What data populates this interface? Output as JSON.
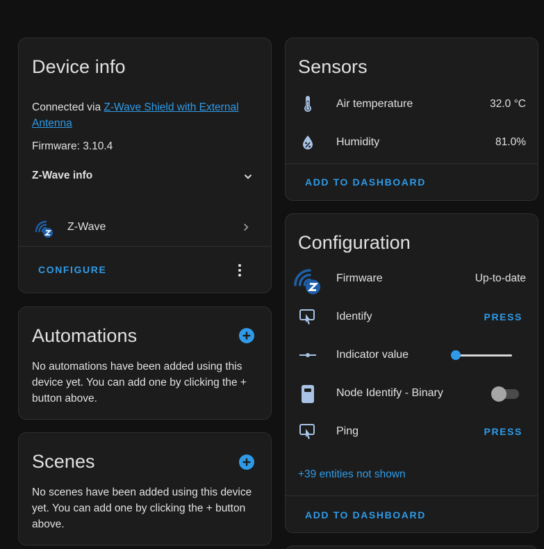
{
  "device_info": {
    "title": "Device info",
    "connected_prefix": "Connected via ",
    "connected_link_line1": "Z-Wave Shield with External",
    "connected_link_line2": "Antenna",
    "firmware": "Firmware: 3.10.4",
    "zwave_info_label": "Z-Wave info",
    "integration_label": "Z-Wave",
    "configure_label": "CONFIGURE"
  },
  "automations": {
    "title": "Automations",
    "description": "No automations have been added using this device yet. You can add one by clicking the + button above."
  },
  "scenes": {
    "title": "Scenes",
    "description": "No scenes have been added using this device yet. You can add one by clicking the + button above."
  },
  "sensors": {
    "title": "Sensors",
    "rows": [
      {
        "label": "Air temperature",
        "value": "32.0 °C",
        "icon": "thermometer-icon"
      },
      {
        "label": "Humidity",
        "value": "81.0%",
        "icon": "water-percent-icon"
      }
    ],
    "add_to_dashboard": "ADD TO DASHBOARD"
  },
  "configuration": {
    "title": "Configuration",
    "rows": [
      {
        "label": "Firmware",
        "value": "Up-to-date",
        "icon": "zwave-logo-icon"
      },
      {
        "label": "Identify",
        "value": "PRESS",
        "icon": "gesture-tap-button-icon"
      },
      {
        "label": "Indicator value",
        "icon": "slider-icon",
        "slider_value": 0
      },
      {
        "label": "Node Identify - Binary",
        "icon": "remote-icon",
        "toggle_on": false
      },
      {
        "label": "Ping",
        "value": "PRESS",
        "icon": "gesture-tap-button-icon"
      }
    ],
    "more_entities": "+39 entities not shown",
    "add_to_dashboard": "ADD TO DASHBOARD"
  },
  "colors": {
    "accent": "#2f9be8",
    "card_bg": "#1c1c1c",
    "page_bg": "#111111"
  }
}
